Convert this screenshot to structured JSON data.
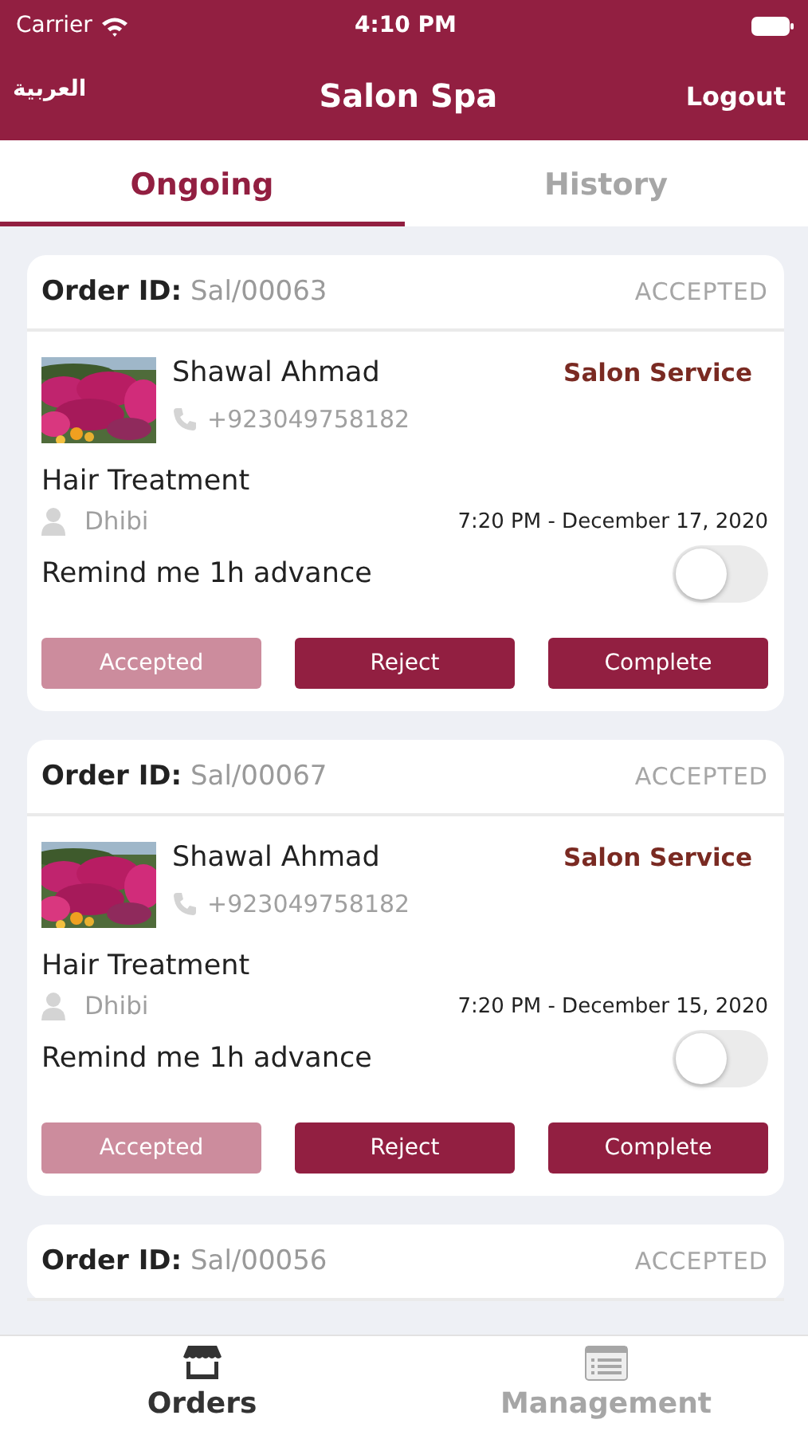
{
  "status_bar": {
    "carrier": "Carrier",
    "time": "4:10 PM"
  },
  "nav": {
    "language": "العربية",
    "title": "Salon Spa",
    "logout": "Logout"
  },
  "tabs": [
    {
      "label": "Ongoing",
      "selected": true
    },
    {
      "label": "History",
      "selected": false
    }
  ],
  "orders": [
    {
      "id_label": "Order ID:",
      "id": "Sal/00063",
      "status": "ACCEPTED",
      "customer": "Shawal Ahmad",
      "service": "Salon Service",
      "phone": "+923049758182",
      "treatment": "Hair Treatment",
      "staff": "Dhibi",
      "datetime": "7:20 PM - December 17, 2020",
      "reminder": {
        "label": "Remind me 1h advance",
        "on": false
      },
      "buttons": [
        {
          "label": "Accepted",
          "disabled": true
        },
        {
          "label": "Reject",
          "disabled": false
        },
        {
          "label": "Complete",
          "disabled": false
        }
      ]
    },
    {
      "id_label": "Order ID:",
      "id": "Sal/00067",
      "status": "ACCEPTED",
      "customer": "Shawal Ahmad",
      "service": "Salon Service",
      "phone": "+923049758182",
      "treatment": "Hair Treatment",
      "staff": "Dhibi",
      "datetime": "7:20 PM - December 15, 2020",
      "reminder": {
        "label": "Remind me 1h advance",
        "on": false
      },
      "buttons": [
        {
          "label": "Accepted",
          "disabled": true
        },
        {
          "label": "Reject",
          "disabled": false
        },
        {
          "label": "Complete",
          "disabled": false
        }
      ]
    },
    {
      "id_label": "Order ID:",
      "id": "Sal/00056",
      "status": "ACCEPTED"
    }
  ],
  "bottom_tabs": [
    {
      "label": "Orders",
      "kind": "store",
      "selected": true
    },
    {
      "label": "Management",
      "kind": "list",
      "selected": false
    }
  ]
}
